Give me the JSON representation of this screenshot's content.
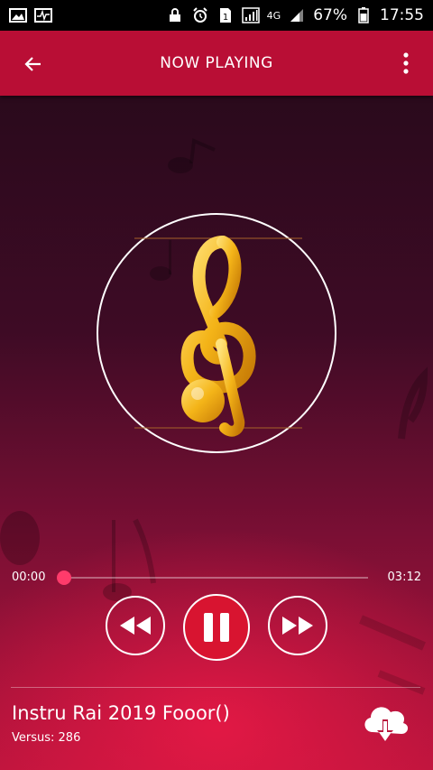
{
  "status_bar": {
    "battery": "67%",
    "time": "17:55",
    "network": "4G",
    "icons": [
      "image-icon",
      "activity-icon",
      "lock-icon",
      "alarm-icon",
      "sim-icon",
      "signal-icon",
      "battery-icon"
    ]
  },
  "app_bar": {
    "title": "NOW PLAYING",
    "back_icon": "arrow-left-icon",
    "menu_icon": "more-vert-icon",
    "color": "#b90e35"
  },
  "player": {
    "elapsed": "00:00",
    "duration": "03:12",
    "progress": 0.0,
    "accent_color": "#ff3b6b",
    "album_art_icon": "treble-clef-icon"
  },
  "controls": {
    "rewind_icon": "rewind-icon",
    "pause_icon": "pause-icon",
    "forward_icon": "fast-forward-icon",
    "pause_color": "#d81430"
  },
  "track": {
    "title": "Instru Rai 2019 Fooor()",
    "subtitle": "Versus: 286",
    "download_icon": "cloud-download-icon"
  }
}
